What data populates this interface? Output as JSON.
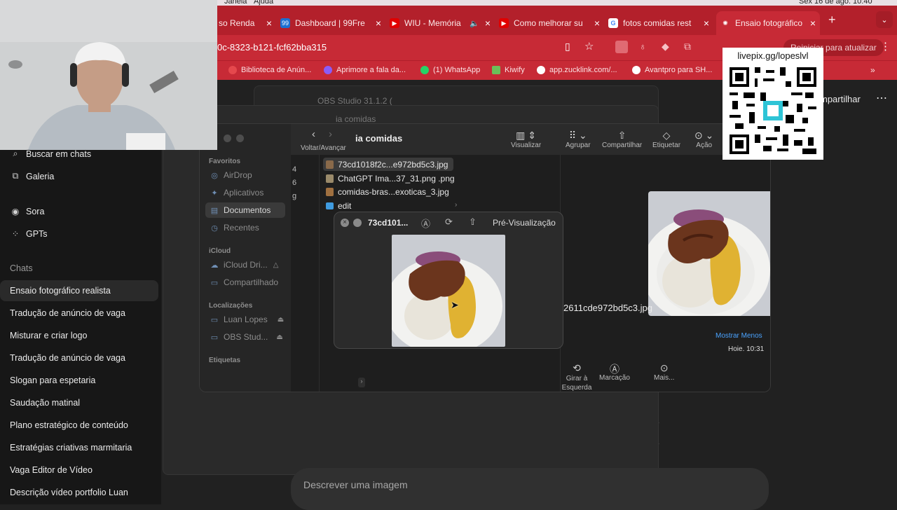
{
  "menubar": {
    "items": [
      "Janela",
      "Ajuda"
    ],
    "clock": "Sex 16 de ago. 10:40"
  },
  "tabs": [
    {
      "label": "so Renda",
      "fav_color": "#1f6b3a",
      "fav_glyph": "₹"
    },
    {
      "label": "Dashboard | 99Fre",
      "fav_color": "#1c6fd1",
      "fav_glyph": "99"
    },
    {
      "label": "WIU - Memória",
      "fav_color": "#e10000",
      "fav_glyph": "▶"
    },
    {
      "label": "Como melhorar su",
      "fav_color": "#e10000",
      "fav_glyph": "▶"
    },
    {
      "label": "fotos comidas rest",
      "fav_color": "#ffffff",
      "fav_glyph": "G"
    },
    {
      "label": "Ensaio fotográfico",
      "fav_color": "#c72a36",
      "fav_glyph": "✺"
    }
  ],
  "url": {
    "text": "0c-8323-b121-fcf62bba315",
    "restart": "Reiniciar para atualizar"
  },
  "bookmarks": [
    {
      "label": "Biblioteca de Anún...",
      "color": "#e5484d"
    },
    {
      "label": "Aprimore a fala da...",
      "color": "#8b5cf6"
    },
    {
      "label": "(1) WhatsApp",
      "color": "#25d366"
    },
    {
      "label": "Kiwify",
      "color": "#6bbf59"
    },
    {
      "label": "app.zucklink.com/...",
      "color": "#ffffff"
    },
    {
      "label": "Avantpro para SH...",
      "color": "#ffffff"
    }
  ],
  "sidebar": {
    "top": [
      {
        "label": "Buscar em chats",
        "icon": "search-icon"
      },
      {
        "label": "Galeria",
        "icon": "gallery-icon"
      },
      {
        "label": "Sora",
        "icon": "sora-icon"
      },
      {
        "label": "GPTs",
        "icon": "gpts-icon"
      }
    ],
    "chats_heading": "Chats",
    "chats": [
      "Ensaio fotográfico realista",
      "Tradução de anúncio de vaga",
      "Misturar e criar logo",
      "Tradução de anúncio de vaga",
      "Slogan para espetaria",
      "Saudação matinal",
      "Plano estratégico de conteúdo",
      "Estratégias criativas marmitaria",
      "Vaga Editor de Vídeo",
      "Descrição vídeo portfolio Luan"
    ]
  },
  "chatgpt": {
    "share": "mpartilhar",
    "input_placeholder": "Descrever uma imagem"
  },
  "obs": {
    "title": "OBS Studio 31.1.2 (",
    "title2": "ia comidas"
  },
  "finder": {
    "folder": "ia comidas",
    "nav_label": "Voltar/Avançar",
    "toolbar": [
      {
        "label": "Visualizar",
        "icon": "columns-icon"
      },
      {
        "label": "Agrupar",
        "icon": "group-icon"
      },
      {
        "label": "Compartilhar",
        "icon": "share-icon"
      },
      {
        "label": "Etiquetar",
        "icon": "tag-icon"
      },
      {
        "label": "Ação",
        "icon": "action-icon"
      }
    ],
    "favorites_heading": "Favoritos",
    "favorites": [
      {
        "label": "AirDrop",
        "icon": "airdrop-icon"
      },
      {
        "label": "Aplicativos",
        "icon": "apps-icon"
      },
      {
        "label": "Documentos",
        "icon": "doc-icon"
      },
      {
        "label": "Recentes",
        "icon": "clock-icon"
      }
    ],
    "icloud_heading": "iCloud",
    "icloud": [
      {
        "label": "iCloud Dri...",
        "icon": "cloud-icon"
      },
      {
        "label": "Compartilhado",
        "icon": "shared-folder-icon"
      }
    ],
    "locations_heading": "Localizações",
    "locations": [
      {
        "label": "Luan Lopes",
        "icon": "disk-icon"
      },
      {
        "label": "OBS Stud...",
        "icon": "disk-icon"
      }
    ],
    "tags_heading": "Etiquetas",
    "files": [
      {
        "name": "73cd1018f2c...e972bd5c3.jpg",
        "type": "jpg"
      },
      {
        "name": "ChatGPT Ima...37_31.png .png",
        "type": "png"
      },
      {
        "name": "comidas-bras...exoticas_3.jpg",
        "type": "jpg"
      },
      {
        "name": "edit",
        "type": "folder"
      }
    ],
    "column_stub": [
      "4",
      "6",
      "g"
    ],
    "preview_name": "2611cde972bd5c3.jpg",
    "show_less": "Mostrar Menos",
    "date": "Hoje, 10:31",
    "actions": [
      {
        "label": "Girar à Esquerda",
        "icon": "rotate-left-icon"
      },
      {
        "label": "Marcação",
        "icon": "markup-icon"
      },
      {
        "label": "Mais...",
        "icon": "more-icon"
      }
    ]
  },
  "quicklook": {
    "title": "73cd101...",
    "open_with": "Pré-Visualização"
  },
  "overlay": {
    "livepix": "livepix.gg/lopeslvl"
  }
}
